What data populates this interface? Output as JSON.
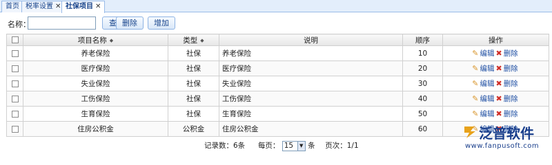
{
  "tabs": [
    {
      "label": "首页",
      "closable": false,
      "active": false
    },
    {
      "label": "税率设置",
      "closable": true,
      "active": false
    },
    {
      "label": "社保项目",
      "closable": true,
      "active": true
    }
  ],
  "toolbar": {
    "name_label": "名称：",
    "search_value": "",
    "query_label": "查询",
    "delete_label": "删除",
    "add_label": "增加"
  },
  "table": {
    "columns": {
      "name": "项目名称",
      "type": "类型",
      "desc": "说明",
      "order": "顺序",
      "ops": "操作"
    },
    "edit_label": "编辑",
    "delete_label": "删除",
    "rows": [
      {
        "name": "养老保险",
        "type": "社保",
        "desc": "养老保险",
        "order": "10"
      },
      {
        "name": "医疗保险",
        "type": "社保",
        "desc": "医疗保险",
        "order": "20"
      },
      {
        "name": "失业保险",
        "type": "社保",
        "desc": "失业保险",
        "order": "30"
      },
      {
        "name": "工伤保险",
        "type": "社保",
        "desc": "工伤保险",
        "order": "40"
      },
      {
        "name": "生育保险",
        "type": "社保",
        "desc": "生育保险",
        "order": "50"
      },
      {
        "name": "住房公积金",
        "type": "公积金",
        "desc": "住房公积金",
        "order": "60"
      }
    ]
  },
  "pager": {
    "records_label": "记录数：",
    "records_value": "6条",
    "per_page_label": "每页：",
    "per_page_value": "15",
    "per_page_unit": "条",
    "page_label": "页次：",
    "page_value": "1/1"
  },
  "watermark": {
    "brand": "泛普软件",
    "url": "www.fanpusoft.com"
  },
  "colors": {
    "tab_border": "#99bbe8",
    "link": "#1f4fa3",
    "delete_icon": "#d0302a",
    "edit_icon": "#d8952b",
    "brand": "#1a3f8c"
  }
}
